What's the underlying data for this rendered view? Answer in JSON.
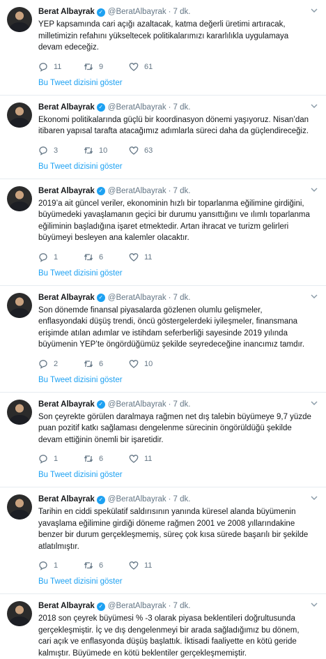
{
  "tweets": [
    {
      "author": "Berat Albayrak",
      "handle": "@BeratAlbayrak",
      "dot": "·",
      "time": "7 dk.",
      "text": "YEP kapsamında cari açığı azaltacak, katma değerli üretimi artıracak, milletimizin refahını yükseltecek politikalarımızı kararlılıkla uygulamaya devam edeceğiz.",
      "replies": "11",
      "retweets": "9",
      "likes": "61",
      "thread_link": "Bu Tweet dizisini göster"
    },
    {
      "author": "Berat Albayrak",
      "handle": "@BeratAlbayrak",
      "dot": "·",
      "time": "7 dk.",
      "text": "Ekonomi politikalarında güçlü bir koordinasyon dönemi yaşıyoruz. Nisan’dan itibaren yapısal tarafta atacağımız adımlarla süreci daha da güçlendireceğiz.",
      "replies": "3",
      "retweets": "10",
      "likes": "63",
      "thread_link": "Bu Tweet dizisini göster"
    },
    {
      "author": "Berat Albayrak",
      "handle": "@BeratAlbayrak",
      "dot": "·",
      "time": "7 dk.",
      "text": "2019’a ait güncel veriler, ekonominin hızlı bir toparlanma eğilimine girdiğini, büyümedeki yavaşlamanın geçici bir durumu yansıttığını ve ılımlı toparlanma eğiliminin başladığına işaret etmektedir. Artan ihracat ve turizm gelirleri büyümeyi besleyen ana kalemler olacaktır.",
      "replies": "1",
      "retweets": "6",
      "likes": "11",
      "thread_link": "Bu Tweet dizisini göster"
    },
    {
      "author": "Berat Albayrak",
      "handle": "@BeratAlbayrak",
      "dot": "·",
      "time": "7 dk.",
      "text": "Son dönemde finansal piyasalarda gözlenen olumlu gelişmeler, enflasyondaki düşüş trendi, öncü göstergelerdeki iyileşmeler, finansmana erişimde atılan adımlar ve istihdam seferberliği sayesinde 2019 yılında büyümenin YEP’te öngördüğümüz şekilde seyredeceğine inancımız tamdır.",
      "replies": "2",
      "retweets": "6",
      "likes": "10",
      "thread_link": "Bu Tweet dizisini göster"
    },
    {
      "author": "Berat Albayrak",
      "handle": "@BeratAlbayrak",
      "dot": "·",
      "time": "7 dk.",
      "text": "Son çeyrekte görülen daralmaya rağmen net dış talebin büyümeye 9,7 yüzde puan pozitif katkı sağlaması dengelenme sürecinin öngörüldüğü şekilde devam ettiğinin önemli bir işaretidir.",
      "replies": "1",
      "retweets": "6",
      "likes": "11",
      "thread_link": "Bu Tweet dizisini göster"
    },
    {
      "author": "Berat Albayrak",
      "handle": "@BeratAlbayrak",
      "dot": "·",
      "time": "7 dk.",
      "text": "Tarihin en ciddi spekülatif saldırısının yanında küresel alanda büyümenin yavaşlama eğilimine girdiği döneme rağmen 2001 ve 2008 yıllarındakine benzer bir durum gerçekleşmemiş, süreç çok kısa sürede başarılı bir şekilde atlatılmıştır.",
      "replies": "1",
      "retweets": "6",
      "likes": "11",
      "thread_link": "Bu Tweet dizisini göster"
    },
    {
      "author": "Berat Albayrak",
      "handle": "@BeratAlbayrak",
      "dot": "·",
      "time": "7 dk.",
      "text": "2018 son çeyrek büyümesi % -3 olarak piyasa beklentileri doğrultusunda gerçekleşmiştir. İç ve dış dengelenmeyi bir arada sağladığımız bu dönem, cari açık ve enflasyonda düşüş başlattık. İktisadi faaliyette en kötü geride kalmıştır. Büyümede en kötü beklentiler gerçekleşmemiştir."
    }
  ]
}
